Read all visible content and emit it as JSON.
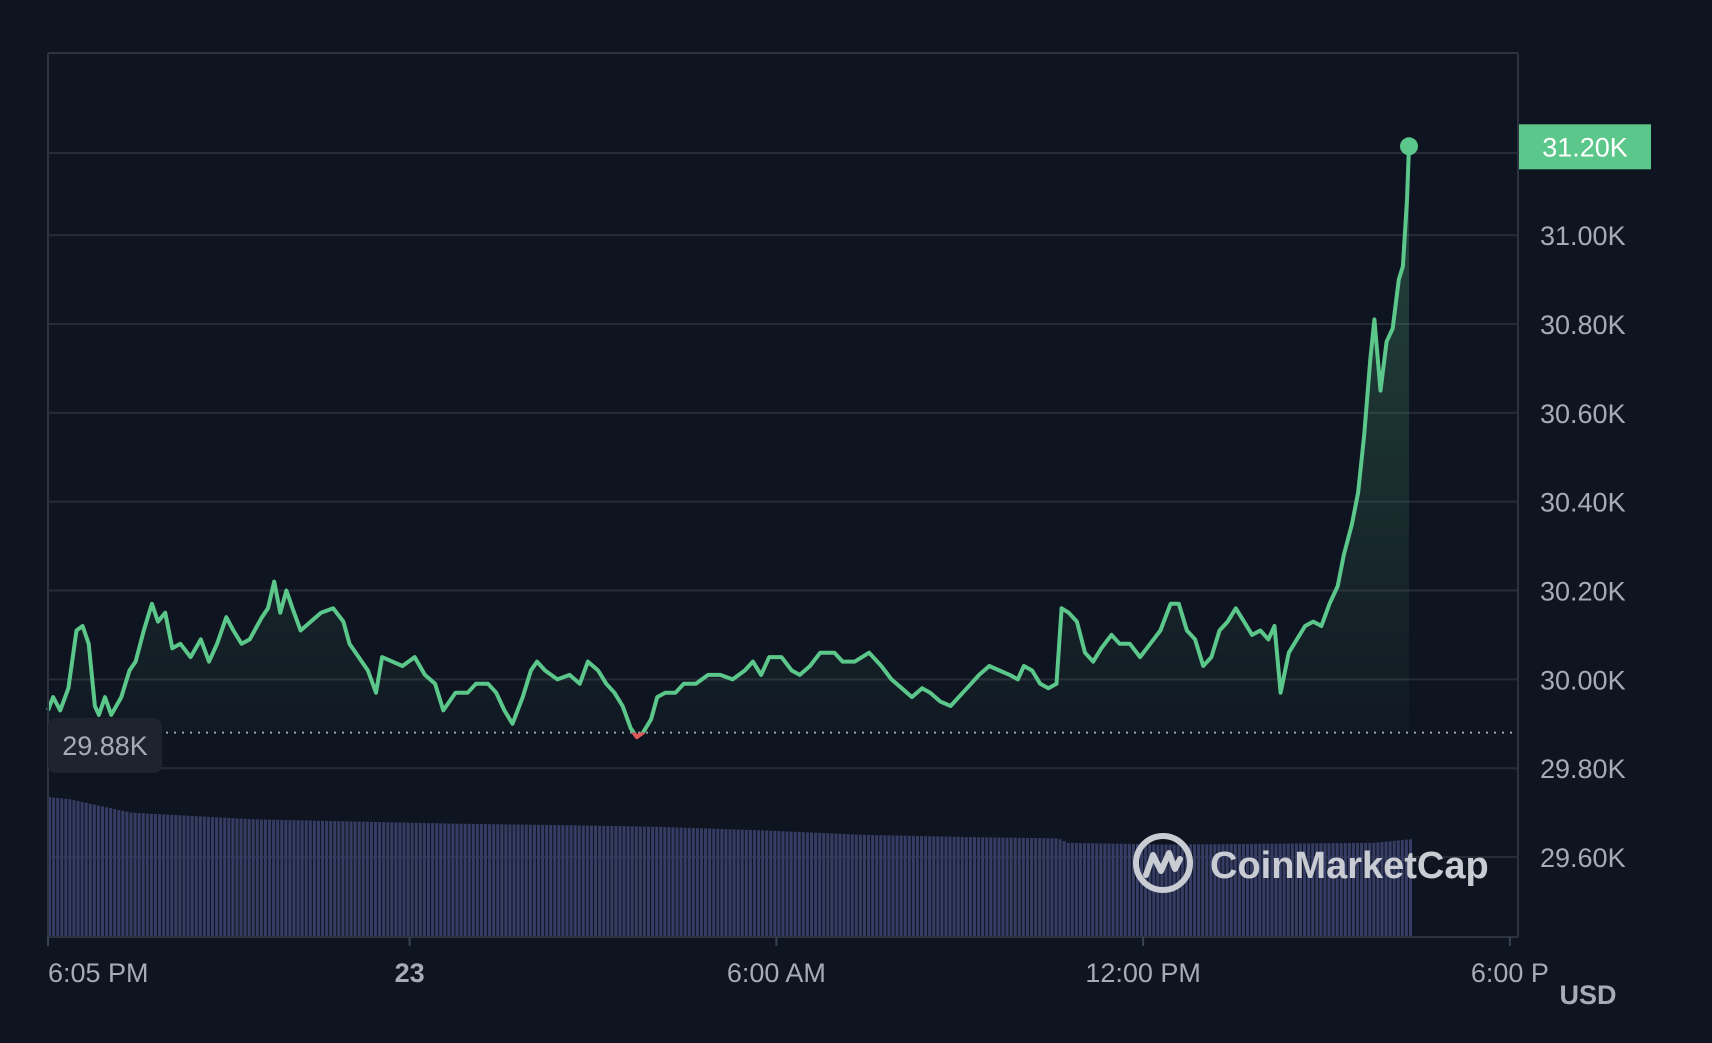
{
  "chart_data": {
    "type": "area",
    "currency_label": "USD",
    "baseline_value": 29880,
    "baseline_label": "29.88K",
    "current_value": 31200,
    "current_label": "31.20K",
    "ylim": [
      29420,
      31410
    ],
    "y_ticks": [
      {
        "value": 29600,
        "label": "29.60K"
      },
      {
        "value": 29800,
        "label": "29.80K"
      },
      {
        "value": 30000,
        "label": "30.00K"
      },
      {
        "value": 30200,
        "label": "30.20K"
      },
      {
        "value": 30400,
        "label": "30.40K"
      },
      {
        "value": 30600,
        "label": "30.60K"
      },
      {
        "value": 30800,
        "label": "30.80K"
      },
      {
        "value": 31000,
        "label": "31.00K"
      }
    ],
    "xlim": [
      0,
      1443
    ],
    "x_ticks": [
      {
        "minute": 0,
        "label": "6:05 PM",
        "bold": false
      },
      {
        "minute": 355,
        "label": "23",
        "bold": true
      },
      {
        "minute": 715,
        "label": "6:00 AM",
        "bold": false
      },
      {
        "minute": 1075,
        "label": "12:00 PM",
        "bold": false
      },
      {
        "minute": 1435,
        "label": "6:00 P",
        "bold": false
      }
    ],
    "series": [
      {
        "x_unit": "minutes after 6:05 PM",
        "points": [
          [
            0,
            29930
          ],
          [
            5,
            29960
          ],
          [
            12,
            29930
          ],
          [
            20,
            29980
          ],
          [
            28,
            30110
          ],
          [
            34,
            30120
          ],
          [
            40,
            30080
          ],
          [
            46,
            29940
          ],
          [
            50,
            29920
          ],
          [
            56,
            29960
          ],
          [
            62,
            29920
          ],
          [
            72,
            29960
          ],
          [
            80,
            30020
          ],
          [
            86,
            30040
          ],
          [
            94,
            30110
          ],
          [
            102,
            30170
          ],
          [
            108,
            30130
          ],
          [
            115,
            30150
          ],
          [
            122,
            30070
          ],
          [
            130,
            30080
          ],
          [
            140,
            30050
          ],
          [
            150,
            30090
          ],
          [
            158,
            30040
          ],
          [
            166,
            30080
          ],
          [
            175,
            30140
          ],
          [
            182,
            30110
          ],
          [
            190,
            30080
          ],
          [
            198,
            30090
          ],
          [
            210,
            30140
          ],
          [
            216,
            30160
          ],
          [
            222,
            30220
          ],
          [
            228,
            30150
          ],
          [
            234,
            30200
          ],
          [
            240,
            30160
          ],
          [
            248,
            30110
          ],
          [
            258,
            30130
          ],
          [
            268,
            30150
          ],
          [
            280,
            30160
          ],
          [
            290,
            30130
          ],
          [
            296,
            30080
          ],
          [
            305,
            30050
          ],
          [
            314,
            30020
          ],
          [
            322,
            29970
          ],
          [
            328,
            30050
          ],
          [
            338,
            30040
          ],
          [
            348,
            30030
          ],
          [
            360,
            30050
          ],
          [
            370,
            30010
          ],
          [
            380,
            29990
          ],
          [
            388,
            29930
          ],
          [
            400,
            29970
          ],
          [
            412,
            29970
          ],
          [
            420,
            29990
          ],
          [
            432,
            29990
          ],
          [
            440,
            29970
          ],
          [
            448,
            29930
          ],
          [
            456,
            29900
          ],
          [
            466,
            29960
          ],
          [
            474,
            30020
          ],
          [
            480,
            30040
          ],
          [
            488,
            30020
          ],
          [
            500,
            30000
          ],
          [
            512,
            30010
          ],
          [
            522,
            29990
          ],
          [
            530,
            30040
          ],
          [
            540,
            30020
          ],
          [
            548,
            29990
          ],
          [
            556,
            29970
          ],
          [
            564,
            29940
          ],
          [
            572,
            29890
          ],
          [
            578,
            29870
          ],
          [
            584,
            29880
          ],
          [
            592,
            29910
          ],
          [
            598,
            29960
          ],
          [
            606,
            29970
          ],
          [
            616,
            29970
          ],
          [
            624,
            29990
          ],
          [
            636,
            29990
          ],
          [
            648,
            30010
          ],
          [
            660,
            30010
          ],
          [
            672,
            30000
          ],
          [
            684,
            30020
          ],
          [
            692,
            30040
          ],
          [
            700,
            30010
          ],
          [
            708,
            30050
          ],
          [
            720,
            30050
          ],
          [
            730,
            30020
          ],
          [
            738,
            30010
          ],
          [
            748,
            30030
          ],
          [
            758,
            30060
          ],
          [
            772,
            30060
          ],
          [
            780,
            30040
          ],
          [
            792,
            30040
          ],
          [
            806,
            30060
          ],
          [
            818,
            30030
          ],
          [
            828,
            30000
          ],
          [
            838,
            29980
          ],
          [
            848,
            29960
          ],
          [
            858,
            29980
          ],
          [
            866,
            29970
          ],
          [
            876,
            29950
          ],
          [
            886,
            29940
          ],
          [
            898,
            29970
          ],
          [
            906,
            29990
          ],
          [
            914,
            30010
          ],
          [
            924,
            30030
          ],
          [
            934,
            30020
          ],
          [
            944,
            30010
          ],
          [
            952,
            30000
          ],
          [
            958,
            30030
          ],
          [
            966,
            30020
          ],
          [
            974,
            29990
          ],
          [
            982,
            29980
          ],
          [
            990,
            29990
          ],
          [
            995,
            30160
          ],
          [
            1002,
            30150
          ],
          [
            1010,
            30130
          ],
          [
            1018,
            30060
          ],
          [
            1026,
            30040
          ],
          [
            1034,
            30070
          ],
          [
            1044,
            30100
          ],
          [
            1052,
            30080
          ],
          [
            1062,
            30080
          ],
          [
            1072,
            30050
          ],
          [
            1082,
            30080
          ],
          [
            1092,
            30110
          ],
          [
            1102,
            30170
          ],
          [
            1110,
            30170
          ],
          [
            1118,
            30110
          ],
          [
            1126,
            30090
          ],
          [
            1134,
            30030
          ],
          [
            1142,
            30050
          ],
          [
            1150,
            30110
          ],
          [
            1158,
            30130
          ],
          [
            1166,
            30160
          ],
          [
            1174,
            30130
          ],
          [
            1182,
            30100
          ],
          [
            1190,
            30110
          ],
          [
            1198,
            30090
          ],
          [
            1204,
            30120
          ],
          [
            1210,
            29970
          ],
          [
            1218,
            30060
          ],
          [
            1226,
            30090
          ],
          [
            1234,
            30120
          ],
          [
            1242,
            30130
          ],
          [
            1250,
            30120
          ],
          [
            1258,
            30170
          ],
          [
            1266,
            30210
          ],
          [
            1272,
            30280
          ],
          [
            1280,
            30350
          ],
          [
            1286,
            30420
          ],
          [
            1292,
            30550
          ],
          [
            1298,
            30720
          ],
          [
            1302,
            30810
          ],
          [
            1308,
            30650
          ],
          [
            1314,
            30760
          ],
          [
            1320,
            30790
          ],
          [
            1326,
            30900
          ],
          [
            1330,
            30930
          ],
          [
            1334,
            31080
          ],
          [
            1336,
            31200
          ]
        ],
        "volume": [
          [
            0,
            29735
          ],
          [
            20,
            29730
          ],
          [
            40,
            29720
          ],
          [
            80,
            29700
          ],
          [
            120,
            29695
          ],
          [
            200,
            29685
          ],
          [
            300,
            29680
          ],
          [
            400,
            29675
          ],
          [
            500,
            29672
          ],
          [
            600,
            29668
          ],
          [
            700,
            29660
          ],
          [
            800,
            29650
          ],
          [
            900,
            29645
          ],
          [
            990,
            29642
          ],
          [
            1000,
            29632
          ],
          [
            1100,
            29628
          ],
          [
            1200,
            29630
          ],
          [
            1300,
            29632
          ],
          [
            1336,
            29640
          ]
        ]
      }
    ]
  },
  "watermark": {
    "text": "CoinMarketCap",
    "icon": "coinmarketcap-logo-icon"
  },
  "colors": {
    "background": "#0f1520",
    "grid": "#252b37",
    "line_up": "#5cc78a",
    "line_down": "#e15a5a",
    "volume": "#363d64",
    "axis_text": "#a6abb6",
    "badge_bg": "#1e232f"
  }
}
